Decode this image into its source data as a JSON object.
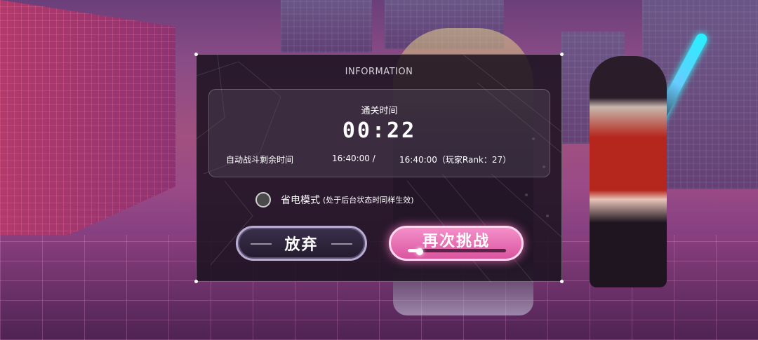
{
  "dialog": {
    "title": "INFORMATION",
    "clear_label": "通关时间",
    "clear_time": "00:22",
    "auto_battle_label": "自动战斗剩余时间",
    "auto_battle_value_1": "16:40:00 /",
    "auto_battle_value_2": "16:40:00（玩家Rank：27）",
    "power_saving_label": "省电模式",
    "power_saving_note": "(处于后台状态时同样生效)",
    "power_saving_checked": false,
    "giveup_label": "放弃",
    "retry_label": "再次挑战",
    "retry_progress": 0.12
  },
  "colors": {
    "retry_accent": "#e56ab0",
    "dialog_bg": "#1a121e"
  }
}
